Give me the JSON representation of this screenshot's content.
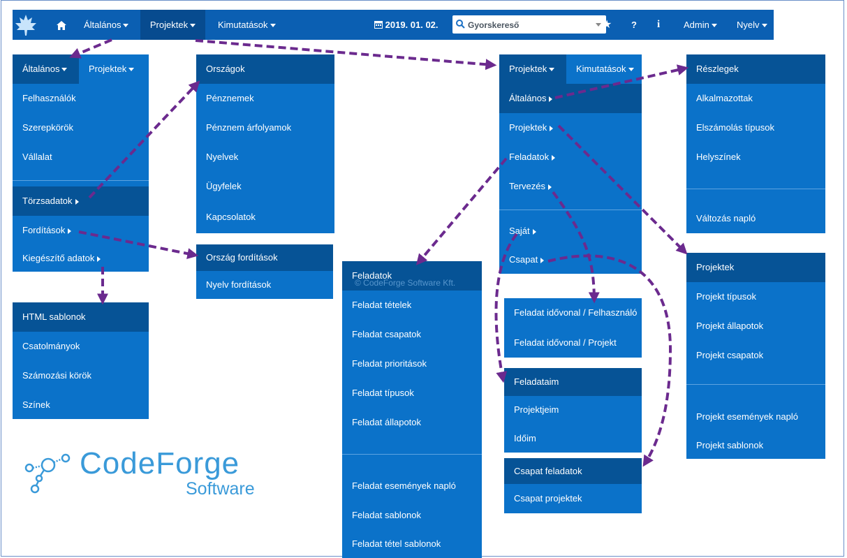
{
  "navbar": {
    "items": [
      "Általános",
      "Projektek",
      "Kimutatások"
    ],
    "date": "2019. 01. 02.",
    "search_placeholder": "Gyorskereső",
    "admin": "Admin",
    "language": "Nyelv",
    "icons": [
      "maple-leaf-logo-icon",
      "home-icon",
      "calendar-icon",
      "search-icon",
      "star-icon",
      "question-icon",
      "info-icon"
    ]
  },
  "menu_general": {
    "tabs": [
      "Általános",
      "Projektek"
    ],
    "items": [
      "Felhasználók",
      "Szerepkörök",
      "Vállalat",
      "Törzsadatok",
      "Fordítások",
      "Kiegészítő adatok"
    ]
  },
  "menu_master": {
    "items": [
      "Országok",
      "Pénznemek",
      "Pénznem árfolyamok",
      "Nyelvek",
      "Ügyfelek",
      "Kapcsolatok"
    ]
  },
  "menu_translations": {
    "items": [
      "Ország fordítások",
      "Nyelv fordítások"
    ]
  },
  "menu_extra": {
    "items": [
      "HTML sablonok",
      "Csatolmányok",
      "Számozási körök",
      "Színek"
    ]
  },
  "menu_projects": {
    "tabs": [
      "Projektek",
      "Kimutatások"
    ],
    "items": [
      "Általános",
      "Projektek",
      "Feladatok",
      "Tervezés",
      "Saját",
      "Csapat"
    ]
  },
  "menu_proj_general": {
    "items": [
      "Részlegek",
      "Alkalmazottak",
      "Elszámolás típusok",
      "Helyszínek",
      "Változás napló"
    ]
  },
  "menu_proj_projects": {
    "items": [
      "Projektek",
      "Projekt típusok",
      "Projekt állapotok",
      "Projekt csapatok",
      "Projekt események napló",
      "Projekt sablonok"
    ]
  },
  "menu_tasks": {
    "items": [
      "Feladatok",
      "Feladat tételek",
      "Feladat csapatok",
      "Feladat prioritások",
      "Feladat típusok",
      "Feladat állapotok",
      "Feladat események napló",
      "Feladat sablonok",
      "Feladat tétel sablonok"
    ]
  },
  "menu_planning": {
    "items": [
      "Feladat idővonal / Felhasználó",
      "Feladat idővonal / Projekt"
    ]
  },
  "menu_own": {
    "items": [
      "Feladataim",
      "Projektjeim",
      "Időim"
    ]
  },
  "menu_team": {
    "items": [
      "Csapat feladatok",
      "Csapat projektek"
    ]
  },
  "watermark": "© CodeForge Software Kft.",
  "logo": {
    "name": "CodeForge",
    "sub": "Software",
    "color": "#3a9ad9"
  },
  "colors": {
    "navbar": "#0b5fb2",
    "menu": "#0b72c9",
    "highlight": "#065396",
    "arrow": "#6b2a8e"
  }
}
